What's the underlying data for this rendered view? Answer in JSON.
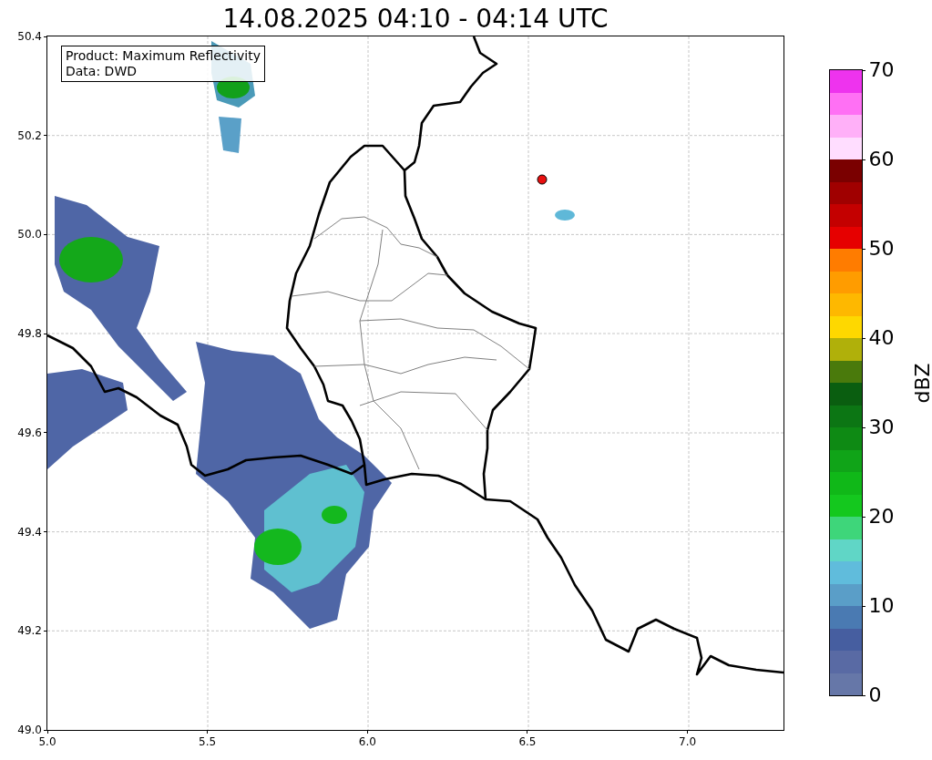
{
  "title": "14.08.2025 04:10 - 04:14 UTC",
  "map": {
    "info_lines": [
      "Product: Maximum Reflectivity",
      "Data: DWD"
    ],
    "xticks": [
      "5.0",
      "5.5",
      "6.0",
      "6.5",
      "7.0"
    ],
    "yticks": [
      "50.4",
      "50.2",
      "50.0",
      "49.8",
      "49.6",
      "49.4",
      "49.2",
      "49.0"
    ]
  },
  "colorbar": {
    "label": "dBZ",
    "ticks": [
      "70",
      "60",
      "50",
      "40",
      "30",
      "20",
      "10",
      "0"
    ],
    "bands": [
      {
        "color": "#6677a8"
      },
      {
        "color": "#596aa4"
      },
      {
        "color": "#465ea0"
      },
      {
        "color": "#4a7ab2"
      },
      {
        "color": "#5a9ec8"
      },
      {
        "color": "#60bcdc"
      },
      {
        "color": "#60d6c6"
      },
      {
        "color": "#3ed67a"
      },
      {
        "color": "#14c81e"
      },
      {
        "color": "#10b818"
      },
      {
        "color": "#10a418"
      },
      {
        "color": "#0e8a14"
      },
      {
        "color": "#0c7614"
      },
      {
        "color": "#0a5e10"
      },
      {
        "color": "#4a7a0c"
      },
      {
        "color": "#b0b00a"
      },
      {
        "color": "#fed800"
      },
      {
        "color": "#feb800"
      },
      {
        "color": "#ff9c00"
      },
      {
        "color": "#ff7c00"
      },
      {
        "color": "#e60000"
      },
      {
        "color": "#c40000"
      },
      {
        "color": "#a00000"
      },
      {
        "color": "#7a0000"
      },
      {
        "color": "#ffddff"
      },
      {
        "color": "#ffb0f8"
      },
      {
        "color": "#ff70f4"
      },
      {
        "color": "#ee33ee"
      }
    ]
  }
}
